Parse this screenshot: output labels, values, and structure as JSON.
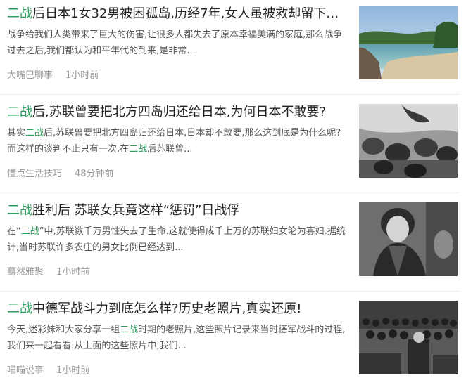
{
  "articles": [
    {
      "title_kw": "二战",
      "title_rest": "后日本1女32男被困孤岛,历经7年,女人虽被救却留下…",
      "summary_pre": "战争给我们人类带来了巨大的伤害,让很多人都失去了原本幸福美满的家庭,那么战争过去之后,我们都认为和平年代的到来,是非常...",
      "summary_kw": "",
      "summary_mid": "",
      "summary_kw2": "",
      "summary_post": "",
      "source": "大嘴巴聊事",
      "time": "1小时前",
      "thumb_icon": "island-beach-photo"
    },
    {
      "title_kw": "二战",
      "title_rest": "后,苏联曾要把北方四岛归还给日本,为何日本不敢要?",
      "summary_pre": "其实",
      "summary_kw": "二战",
      "summary_mid": "后,苏联曾要把北方四岛归还给日本,日本却不敢要,那么这到底是为什么呢?而这样的谈判不止只有一次,在",
      "summary_kw2": "二战",
      "summary_post": "后苏联曾...",
      "source": "懂点生活技巧",
      "time": "48分钟前",
      "thumb_icon": "soldiers-bw-photo"
    },
    {
      "title_kw": "二战",
      "title_rest": "胜利后 苏联女兵竟这样“惩罚”日战俘",
      "summary_pre": "在“",
      "summary_kw": "二战",
      "summary_mid": "”中,苏联数千万男性失去了生命.这就使得成千上万的苏联妇女沦为寡妇.据统计,当时苏联许多农庄的男女比例已经达到...",
      "summary_kw2": "",
      "summary_post": "",
      "source": "蓦然雅聚",
      "time": "1小时前",
      "thumb_icon": "woman-soldier-bw-photo"
    },
    {
      "title_kw": "二战",
      "title_rest": "中德军战斗力到底怎么样?历史老照片,真实还原!",
      "summary_pre": "今天,迷彩妹和大家分享一组",
      "summary_kw": "二战",
      "summary_mid": "时期的老照片,这些照片记录来当时德军战斗的过程,我们来一起看看:从上面的这些照片中,我们...",
      "summary_kw2": "",
      "summary_post": "",
      "source": "喵喵说事",
      "time": "1小时前",
      "thumb_icon": "crowd-rally-bw-photo"
    }
  ]
}
